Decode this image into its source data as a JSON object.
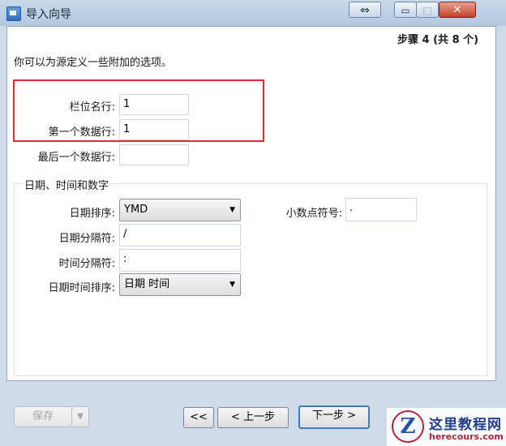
{
  "window": {
    "title": "导入向导",
    "resize_icon": "⇔",
    "min_icon": "▭",
    "max_icon": "□",
    "close_icon": "✕"
  },
  "step": "步骤 4 (共 8 个)",
  "intro": "你可以为源定义一些附加的选项。",
  "fields": {
    "header_row_label": "栏位名行:",
    "header_row_value": "1",
    "first_data_row_label": "第一个数据行:",
    "first_data_row_value": "1",
    "last_data_row_label": "最后一个数据行:",
    "last_data_row_value": ""
  },
  "group": {
    "title": "日期、时间和数字",
    "date_order_label": "日期排序:",
    "date_order_value": "YMD",
    "decimal_symbol_label": "小数点符号:",
    "decimal_symbol_value": ".",
    "date_separator_label": "日期分隔符:",
    "date_separator_value": "/",
    "time_separator_label": "时间分隔符:",
    "time_separator_value": ":",
    "datetime_order_label": "日期时间排序:",
    "datetime_order_value": "日期 时间"
  },
  "buttons": {
    "save": "保存",
    "save_arrow": "▼",
    "first": "<<",
    "prev": "< 上一步",
    "next": "下一步 >"
  },
  "watermark": {
    "logo_letter": "Z",
    "name": "这里教程网",
    "url": "herecours.com"
  },
  "colors": {
    "highlight": "#e02a37",
    "titlebar": "#b3c8df",
    "default_button_border": "#3d7bc4"
  }
}
